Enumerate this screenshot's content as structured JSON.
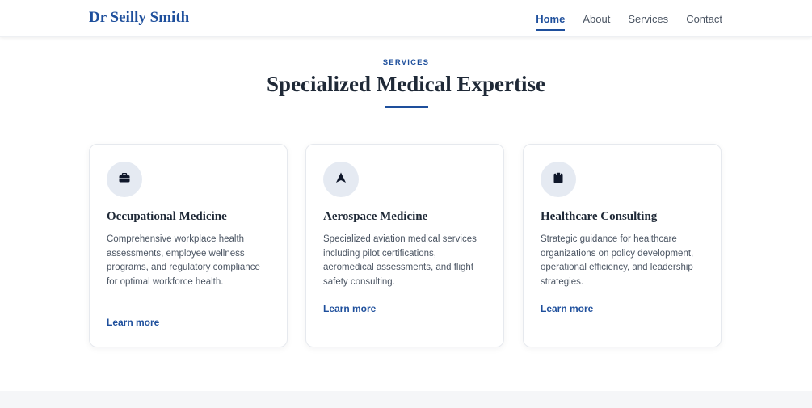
{
  "site": {
    "brand": "Dr Seilly Smith"
  },
  "nav": {
    "items": [
      {
        "label": "Home",
        "active": true
      },
      {
        "label": "About",
        "active": false
      },
      {
        "label": "Services",
        "active": false
      },
      {
        "label": "Contact",
        "active": false
      }
    ]
  },
  "section": {
    "eyebrow": "SERVICES",
    "title": "Specialized Medical Expertise"
  },
  "cards": [
    {
      "icon": "briefcase-icon",
      "title": "Occupational Medicine",
      "description": "Comprehensive workplace health assessments, employee wellness programs, and regulatory compliance for optimal workforce health.",
      "link": "Learn more"
    },
    {
      "icon": "plane-icon",
      "title": "Aerospace Medicine",
      "description": "Specialized aviation medical services including pilot certifications, aeromedical assessments, and flight safety consulting.",
      "link": "Learn more"
    },
    {
      "icon": "clipboard-icon",
      "title": "Healthcare Consulting",
      "description": "Strategic guidance for healthcare organizations on policy development, operational efficiency, and leadership strategies.",
      "link": "Learn more"
    }
  ],
  "colors": {
    "primary": "#1e4f9c",
    "text": "#1f2937",
    "muted": "#4b5563",
    "icon_bg": "#e5eaf2"
  }
}
